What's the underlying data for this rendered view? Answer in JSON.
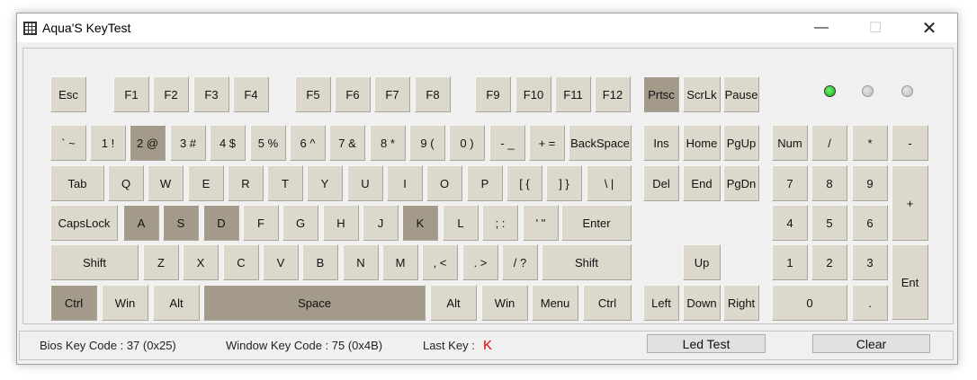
{
  "window": {
    "title": "Aqua'S KeyTest"
  },
  "keyboard": {
    "main": [
      [
        "Esc",
        "F1",
        "F2",
        "F3",
        "F4",
        "F5",
        "F6",
        "F7",
        "F8",
        "F9",
        "F10",
        "F11",
        "F12"
      ],
      [
        "` ~",
        "1 !",
        "2 @",
        "3 #",
        "4 $",
        "5 %",
        "6 ^",
        "7 &",
        "8 *",
        "9 (",
        "0 )",
        "- _",
        "+ =",
        "BackSpace"
      ],
      [
        "Tab",
        "Q",
        "W",
        "E",
        "R",
        "T",
        "Y",
        "U",
        "I",
        "O",
        "P",
        "[ {",
        "] }",
        "\\ |"
      ],
      [
        "CapsLock",
        "A",
        "S",
        "D",
        "F",
        "G",
        "H",
        "J",
        "K",
        "L",
        "; :",
        "' \"",
        "Enter"
      ],
      [
        "Shift",
        "Z",
        "X",
        "C",
        "V",
        "B",
        "N",
        "M",
        ", <",
        ". >",
        "/ ?",
        "Shift"
      ],
      [
        "Ctrl",
        "Win",
        "Alt",
        "Space",
        "Alt",
        "Win",
        "Menu",
        "Ctrl"
      ]
    ],
    "nav": [
      [
        "Prtsc",
        "ScrLk",
        "Pause"
      ],
      [
        "Ins",
        "Home",
        "PgUp"
      ],
      [
        "Del",
        "End",
        "PgDn"
      ],
      [
        "Up"
      ],
      [
        "Left",
        "Down",
        "Right"
      ]
    ],
    "numpad": [
      [
        "Num",
        "/",
        "*",
        "-"
      ],
      [
        "7",
        "8",
        "9",
        "+"
      ],
      [
        "4",
        "5",
        "6"
      ],
      [
        "1",
        "2",
        "3",
        "Ent"
      ],
      [
        "0",
        "."
      ]
    ],
    "pressed_keys": [
      "W",
      "A",
      "S",
      "D",
      "K",
      "Ctrl (left)",
      "Space",
      "Prtsc"
    ],
    "leds": [
      {
        "name": "num-lock",
        "state": "on",
        "color": "#22c722"
      },
      {
        "name": "caps-lock",
        "state": "off",
        "color": "#c4c4c4"
      },
      {
        "name": "scroll-lock",
        "state": "off",
        "color": "#c4c4c4"
      }
    ],
    "colors": {
      "key": "#dcd9cc",
      "pressed": "#a39a89"
    }
  },
  "status": {
    "bios_label": "Bios Key Code : 37 (0x25)",
    "window_label": "Window Key Code : 75 (0x4B)",
    "last_key_label": "Last Key :",
    "last_key_value": "K",
    "last_key_color": "#e00000",
    "led_test_button": "Led Test",
    "clear_button": "Clear"
  }
}
